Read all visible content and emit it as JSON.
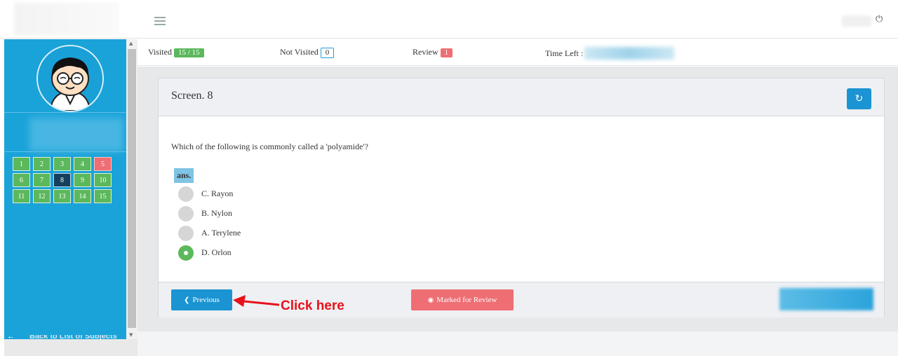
{
  "header": {
    "menu_icon": "hamburger-icon",
    "power_icon": "power-icon",
    "power_glyph": "⏻"
  },
  "sidebar": {
    "question_numbers": [
      {
        "num": "1",
        "state": "visited"
      },
      {
        "num": "2",
        "state": "visited"
      },
      {
        "num": "3",
        "state": "visited"
      },
      {
        "num": "4",
        "state": "visited"
      },
      {
        "num": "5",
        "state": "review"
      },
      {
        "num": "6",
        "state": "visited"
      },
      {
        "num": "7",
        "state": "visited"
      },
      {
        "num": "8",
        "state": "current"
      },
      {
        "num": "9",
        "state": "visited"
      },
      {
        "num": "10",
        "state": "visited"
      },
      {
        "num": "11",
        "state": "visited"
      },
      {
        "num": "12",
        "state": "visited"
      },
      {
        "num": "13",
        "state": "visited"
      },
      {
        "num": "14",
        "state": "visited"
      },
      {
        "num": "15",
        "state": "visited"
      }
    ],
    "back_label": "Back to List of Subjects",
    "back_arrow": "←"
  },
  "status": {
    "visited_label": "Visited",
    "visited_value": "15 / 15",
    "not_visited_label": "Not Visited",
    "not_visited_value": "0",
    "review_label": "Review",
    "review_value": "1",
    "time_left_label": "Time Left :"
  },
  "card": {
    "title": "Screen. 8",
    "refresh_glyph": "↻",
    "question": "Which of the following is commonly called a 'polyamide'?",
    "ans_label": "ans.",
    "options": [
      {
        "label": "C. Rayon",
        "selected": false
      },
      {
        "label": "B. Nylon",
        "selected": false
      },
      {
        "label": "A. Terylene",
        "selected": false
      },
      {
        "label": "D. Orlon",
        "selected": true
      }
    ],
    "previous_label": "Previous",
    "previous_icon": "❮",
    "review_button_label": "Marked for Review",
    "review_icon": "◉"
  },
  "annotation": {
    "text": "Click here"
  },
  "colors": {
    "sidebar": "#1aa3d9",
    "visited": "#5cb85c",
    "review": "#ee6e73",
    "current": "#153f5c",
    "primary_button": "#1a94d2",
    "annotation": "#e8111b"
  }
}
